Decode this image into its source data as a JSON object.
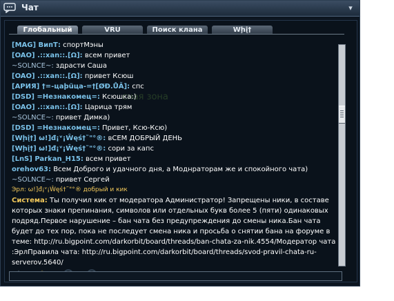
{
  "window": {
    "title": "Чат",
    "collapse_glyph": "▾"
  },
  "tabs": [
    {
      "label": "Глобальный",
      "active": true
    },
    {
      "label": "VRU",
      "active": false
    },
    {
      "label": "Поиск клана",
      "active": false
    },
    {
      "label": "Wḩį†",
      "active": false
    }
  ],
  "watermark": "сная зона",
  "messages": [
    {
      "nick": "[MAG] ВипТ:",
      "text": " спортМэны"
    },
    {
      "nick": "[OAO] .::xan::.[Ω]:",
      "text": " всем привет"
    },
    {
      "nick": "~SOLNCE~:",
      "text": " здрасти Саша"
    },
    {
      "nick": "[OAO] .::xan::.[Ω]:",
      "text": " привет Ксюш"
    },
    {
      "nick": "[АРИЯ] †=-цаϸũца-=†[ØÐ.ŮĂ]:",
      "text": " спс"
    },
    {
      "nick": "[DSD] =Незнакомец=:",
      "text": " Ксюшка:)"
    },
    {
      "nick": "[OAO] .::xan::.[Ω]:",
      "text": " Царица трям"
    },
    {
      "nick": "~SOLNCE~:",
      "text": " привет Димка)"
    },
    {
      "nick": "[DSD] =Незнакомец=:",
      "text": " Привет, Ксю-Ксю)"
    },
    {
      "nick": "[Wḩį†] ω!]đ¡ᵛ¡Ŵęś†˜\"°®:",
      "text": " вСЕМ ДОБРЫЙ ДЕНЬ"
    },
    {
      "nick": "[Wḩį†] ω!]đ¡ᵛ¡Ŵęś†˜\"°®:",
      "text": " сори за капс"
    },
    {
      "nick": "[LnS] Parkan_H15:",
      "text": " всем привет"
    },
    {
      "nick": "orehov63:",
      "text": " Всем Доброго и удачного дня, а Моднраторам же и спокойного чата)"
    },
    {
      "nick": "~SOLNCE~:",
      "text": " привет Сергей"
    }
  ],
  "announce": "Эрл: ω!]đ¡ᵛ¡Ŵęś†˜\"°® добрый и кик",
  "system": {
    "label": "Система:",
    "text": " Ты получил кик от модератора Администратор! Запрещены ники, в составе которых знаки препинания, символов или отдельных букв более 5 (пяти) одинаковых подряд.Первое нарушение – бан чата без предупреждения до смены ника.Бан чата будет до тех пор, пока не последует смена ника и просьба о снятии бана на форуме в теме: http://ru.bigpoint.com/darkorbit/board/threads/ban-chata-za-nik.4554/Модератор чата :ЭрлПравила чата: http://ru.bigpoint.com/darkorbit/board/threads/svod-pravil-chata-ru-serverov.5640/"
  },
  "input": {
    "value": ""
  },
  "colors": {
    "nick": "#7ac1e8",
    "system_label": "#f2c85a",
    "text": "#ffffff",
    "background": "#0a121b"
  }
}
